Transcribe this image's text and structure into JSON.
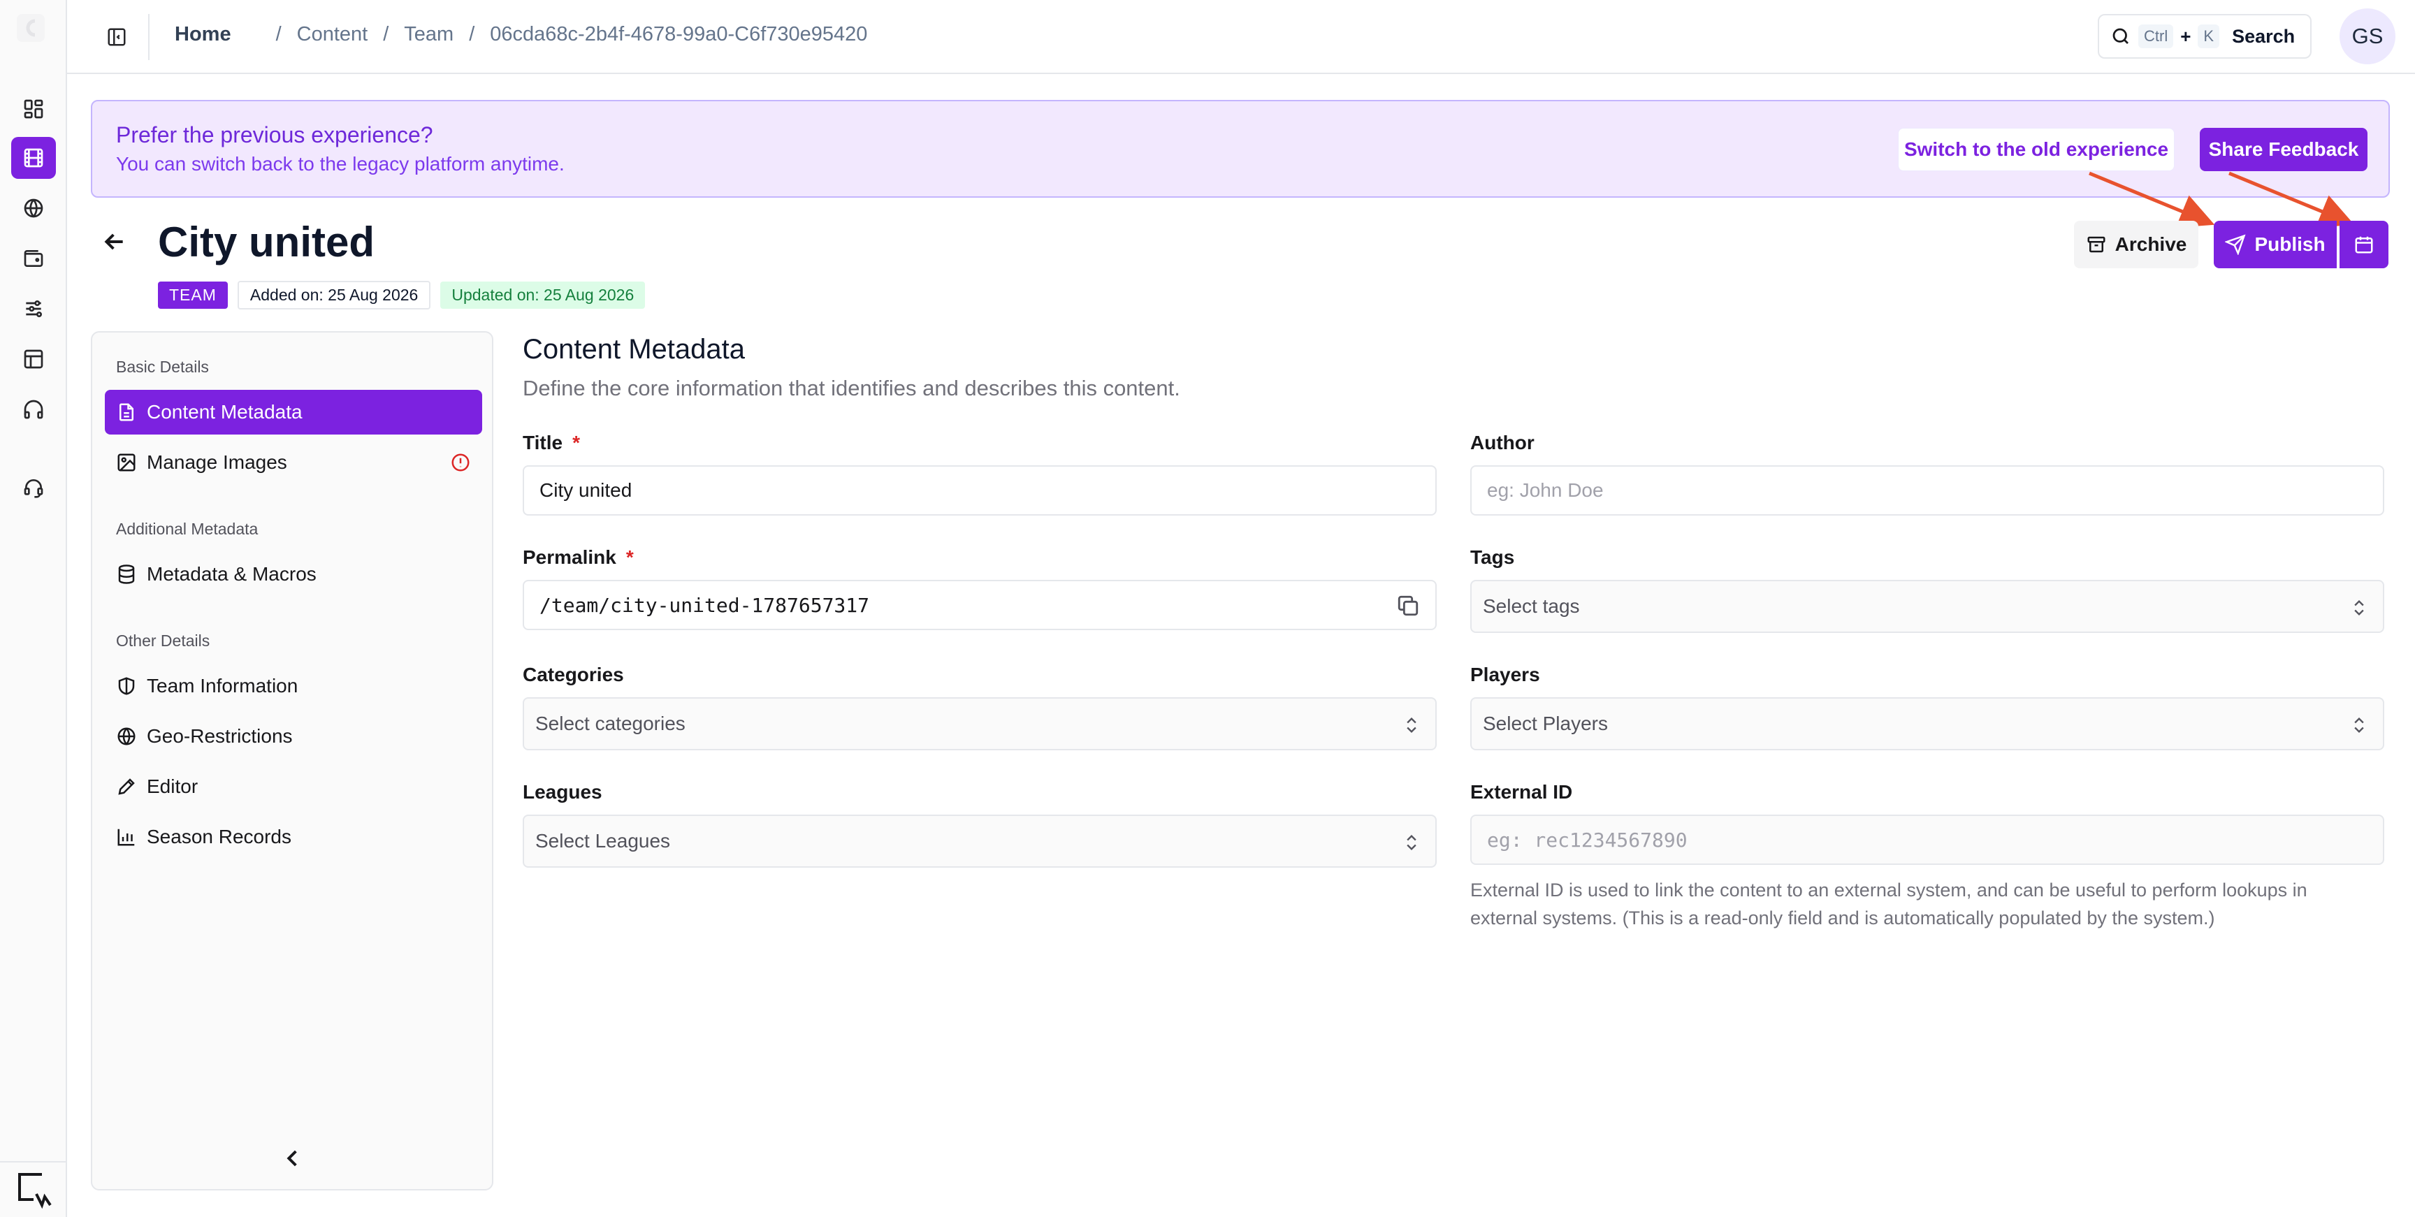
{
  "breadcrumb": {
    "home": "Home",
    "items": [
      "Content",
      "Team",
      "06cda68c-2b4f-4678-99a0-C6f730e95420"
    ]
  },
  "search": {
    "kbd_ctrl": "Ctrl",
    "plus": "+",
    "kbd_k": "K",
    "label": "Search"
  },
  "user": {
    "initials": "GS"
  },
  "banner": {
    "title": "Prefer the previous experience?",
    "subtitle": "You can switch back to the legacy platform anytime.",
    "switch_label": "Switch to the old experience",
    "feedback_label": "Share Feedback"
  },
  "page": {
    "title": "City united",
    "badge_type": "TEAM",
    "added": "Added on: 25 Aug 2026",
    "updated": "Updated on: 25 Aug 2026",
    "archive_label": "Archive",
    "publish_label": "Publish"
  },
  "nav": {
    "group_basic": "Basic Details",
    "group_additional": "Additional Metadata",
    "group_other": "Other Details",
    "items": [
      {
        "label": "Content Metadata"
      },
      {
        "label": "Manage Images"
      },
      {
        "label": "Metadata & Macros"
      },
      {
        "label": "Team Information"
      },
      {
        "label": "Geo-Restrictions"
      },
      {
        "label": "Editor"
      },
      {
        "label": "Season Records"
      }
    ]
  },
  "form": {
    "section_title": "Content Metadata",
    "section_desc": "Define the core information that identifies and describes this content.",
    "title_label": "Title",
    "title_value": "City united",
    "author_label": "Author",
    "author_placeholder": "eg: John Doe",
    "permalink_label": "Permalink",
    "permalink_value": "/team/city-united-1787657317",
    "tags_label": "Tags",
    "tags_placeholder": "Select tags",
    "categories_label": "Categories",
    "categories_placeholder": "Select categories",
    "players_label": "Players",
    "players_placeholder": "Select Players",
    "leagues_label": "Leagues",
    "leagues_placeholder": "Select Leagues",
    "external_label": "External ID",
    "external_placeholder": "eg: rec1234567890",
    "external_help": "External ID is used to link the content to an external system, and can be useful to perform lookups in external systems. (This is a read-only field and is automatically populated by the system.)",
    "required_mark": "*"
  },
  "colors": {
    "accent": "#7c22e0",
    "banner_bg": "#f2e8fe",
    "annotation_arrow": "#e8522e",
    "updated_badge_bg": "#dcfce7"
  }
}
